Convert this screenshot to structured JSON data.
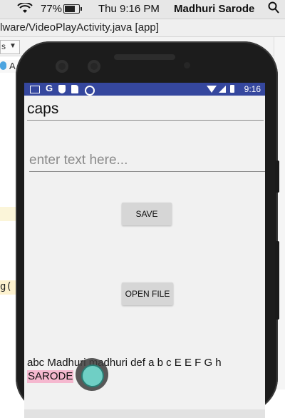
{
  "menubar": {
    "battery_percent": "77%",
    "clock": "Thu 9:16 PM",
    "user_name": "Madhuri Sarode"
  },
  "ide": {
    "title": "lware/VideoPlayActivity.java [app]",
    "dropdown_label": "s",
    "tab_label": "A",
    "code_fragment": "g("
  },
  "phone": {
    "status_time": "9:16",
    "caps_text": "caps",
    "input_placeholder": "enter text here...",
    "save_label": "SAVE",
    "open_file_label": "OPEN FILE",
    "output_line1": "abc Madhuri madhuri def a b c E E F G h",
    "output_line2": "SARODE"
  },
  "colors": {
    "status_bar": "#35479e",
    "highlight": "#f5b8cf",
    "touch_indicator": "#6fcfc5"
  }
}
